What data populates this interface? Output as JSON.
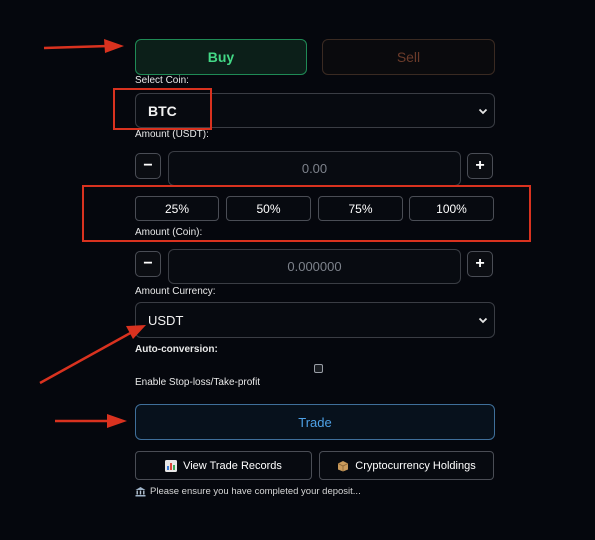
{
  "side": {
    "buy_label": "Buy",
    "sell_label": "Sell"
  },
  "coin": {
    "label": "Select Coin:",
    "value": "BTC"
  },
  "amount_usdt": {
    "label": "Amount (USDT):",
    "value": "0.00",
    "minus": "−",
    "plus": "+"
  },
  "percents": [
    "25%",
    "50%",
    "75%",
    "100%"
  ],
  "amount_coin": {
    "label": "Amount (Coin):",
    "value": "0.000000",
    "minus": "−",
    "plus": "+"
  },
  "currency": {
    "label": "Amount Currency:",
    "value": "USDT"
  },
  "auto_conversion_label": "Auto-conversion:",
  "stop_loss_label": "Enable Stop-loss/Take-profit",
  "trade_label": "Trade",
  "links": {
    "records": "View Trade Records",
    "holdings": "Cryptocurrency Holdings"
  },
  "notice": "Please ensure you have completed your deposit...",
  "colors": {
    "background": "#05070d",
    "buy": "#43d886",
    "sell": "#6b3b2a",
    "trade": "#4ea1e6",
    "annotation": "#d9321f"
  }
}
